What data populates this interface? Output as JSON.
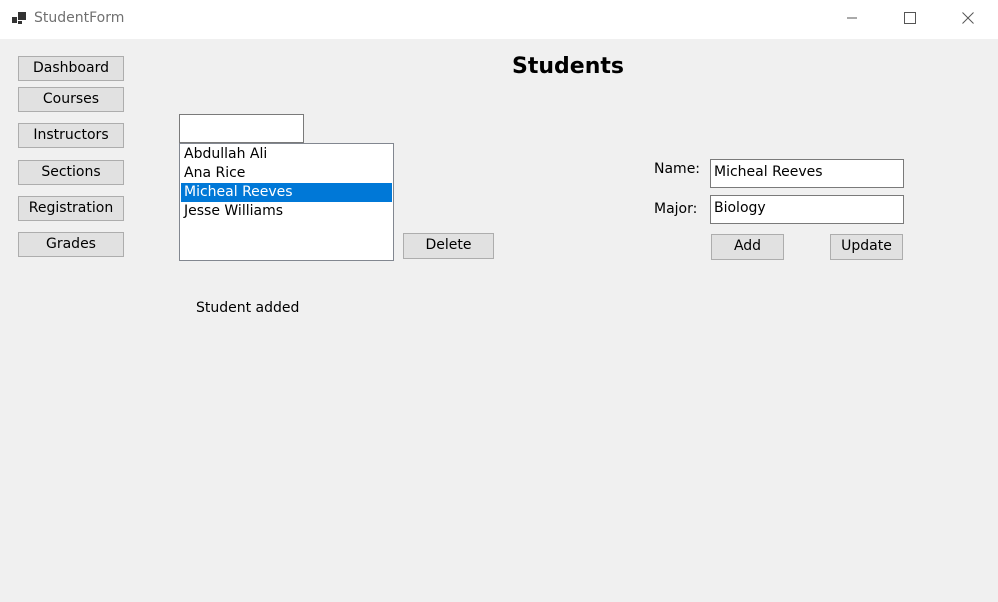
{
  "window": {
    "title": "StudentForm",
    "icon": "app-form-icon",
    "controls": {
      "minimize": "minimize-icon",
      "maximize": "maximize-icon",
      "close": "close-icon"
    }
  },
  "nav": {
    "dashboard": "Dashboard",
    "courses": "Courses",
    "instructors": "Instructors",
    "sections": "Sections",
    "registration": "Registration",
    "grades": "Grades"
  },
  "main": {
    "title": "Students",
    "search_value": "",
    "students": {
      "0": "Abdullah Ali",
      "1": "Ana Rice",
      "2": "Micheal Reeves",
      "3": "Jesse Williams"
    },
    "selected_index": 2,
    "delete_label": "Delete",
    "status": "Student added"
  },
  "form": {
    "name_label": "Name:",
    "name_value": "Micheal Reeves",
    "major_label": "Major:",
    "major_value": "Biology",
    "add_label": "Add",
    "update_label": "Update"
  },
  "colors": {
    "selection": "#0078d7",
    "button_bg": "#e1e1e1",
    "window_bg": "#f0f0f0"
  }
}
